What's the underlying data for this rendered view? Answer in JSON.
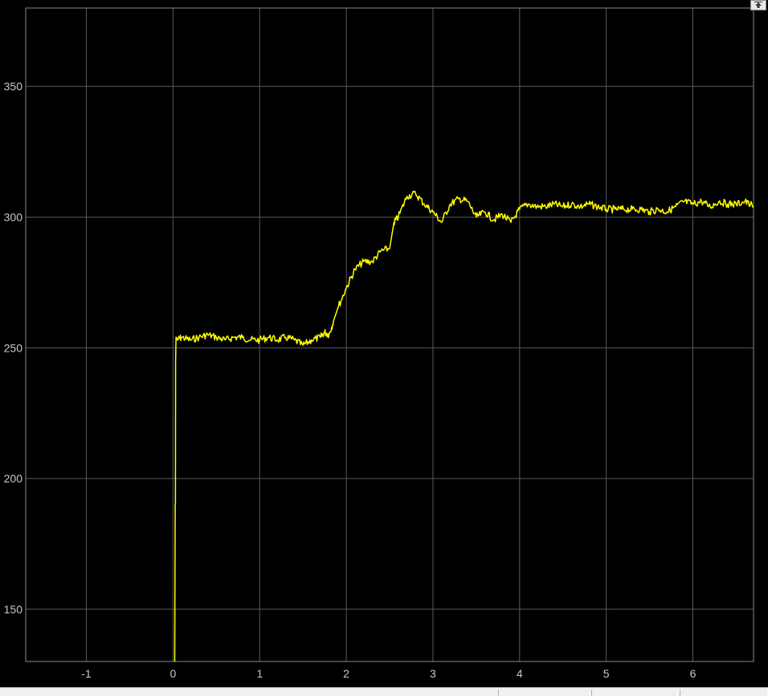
{
  "colors": {
    "background": "#000000",
    "axes_border": "#8a8a8a",
    "grid": "#5a5a5a",
    "tick_label": "#c8c8c8",
    "signal": "#ffff00"
  },
  "icons": {
    "restore": "expand-arrow-icon"
  },
  "chart_data": {
    "type": "line",
    "title": "",
    "xlabel": "",
    "ylabel": "",
    "xlim": [
      -1.7,
      6.7
    ],
    "ylim": [
      130,
      380
    ],
    "grid": true,
    "x_ticks": [
      -1,
      0,
      1,
      2,
      3,
      4,
      5,
      6
    ],
    "x_tick_labels": [
      "-1",
      "0",
      "1",
      "2",
      "3",
      "4",
      "5",
      "6"
    ],
    "y_ticks": [
      150,
      200,
      250,
      300,
      350
    ],
    "y_tick_labels": [
      "150",
      "200",
      "250",
      "300",
      "350"
    ],
    "series": [
      {
        "color": "#ffff00",
        "x": [
          0.02,
          0.025,
          0.028,
          0.03,
          0.035,
          0.04,
          0.05,
          0.1,
          0.2,
          0.3,
          0.4,
          0.5,
          0.6,
          0.7,
          0.8,
          0.9,
          1.0,
          1.1,
          1.2,
          1.3,
          1.4,
          1.5,
          1.6,
          1.7,
          1.75,
          1.8,
          1.85,
          1.9,
          2.0,
          2.1,
          2.2,
          2.3,
          2.4,
          2.5,
          2.55,
          2.6,
          2.7,
          2.8,
          2.9,
          3.0,
          3.1,
          3.2,
          3.3,
          3.4,
          3.5,
          3.6,
          3.7,
          3.8,
          3.9,
          4.0,
          4.1,
          4.2,
          4.3,
          4.4,
          4.5,
          4.6,
          4.7,
          4.8,
          4.9,
          5.0,
          5.1,
          5.2,
          5.3,
          5.4,
          5.5,
          5.6,
          5.7,
          5.8,
          5.9,
          6.0,
          6.1,
          6.2,
          6.3,
          6.4,
          6.5,
          6.6,
          6.7
        ],
        "y": [
          130,
          190,
          190,
          245,
          254,
          254,
          253,
          254,
          253,
          254,
          255,
          254,
          253,
          254,
          254,
          253,
          253,
          254,
          253,
          254,
          253,
          251,
          253,
          254,
          256,
          255,
          260,
          265,
          273,
          280,
          283,
          283,
          287,
          288,
          298,
          300,
          308,
          309,
          305,
          302,
          298,
          305,
          307,
          306,
          300,
          302,
          299,
          301,
          298,
          303,
          305,
          304,
          304,
          305,
          304,
          305,
          304,
          305,
          304,
          303,
          303,
          303,
          303,
          303,
          302,
          303,
          302,
          304,
          306,
          305,
          306,
          304,
          306,
          305,
          305,
          306,
          304
        ]
      }
    ]
  }
}
